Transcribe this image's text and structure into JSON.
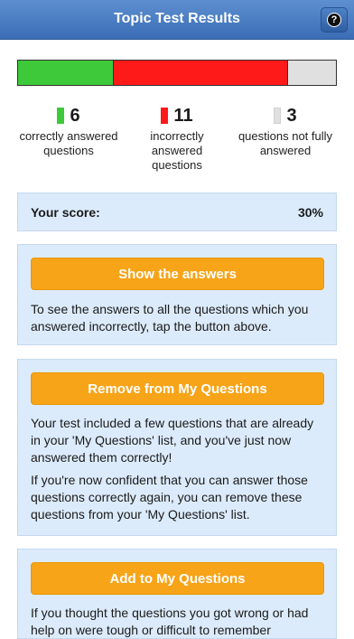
{
  "header": {
    "title": "Topic Test Results",
    "help_label": "?"
  },
  "progress": {
    "correct": 6,
    "incorrect": 11,
    "not_answered": 3,
    "colors": {
      "correct": "#3dc93a",
      "incorrect": "#ff1a1a",
      "not_answered": "#e0e0e0"
    }
  },
  "stats": [
    {
      "count": "6",
      "label_lines": [
        "correctly answered",
        "questions"
      ]
    },
    {
      "count": "11",
      "label_lines": [
        "incorrectly",
        "answered",
        "questions"
      ]
    },
    {
      "count": "3",
      "label_lines": [
        "questions not fully",
        "answered"
      ]
    }
  ],
  "score": {
    "label": "Your score:",
    "value": "30%"
  },
  "show_answers": {
    "button_label": "Show the answers",
    "text": "To see the answers to all the questions which you answered incorrectly, tap the button above."
  },
  "remove": {
    "button_label": "Remove from My Questions",
    "text1": "Your test included a few questions that are already in your 'My Questions' list, and you've just now answered them correctly!",
    "text2": "If you're now confident that you can answer those questions correctly again, you can remove these questions from your 'My Questions' list."
  },
  "add": {
    "button_label": "Add to My Questions",
    "text": "If you thought the questions you got wrong or had help on were tough or difficult to remember"
  }
}
